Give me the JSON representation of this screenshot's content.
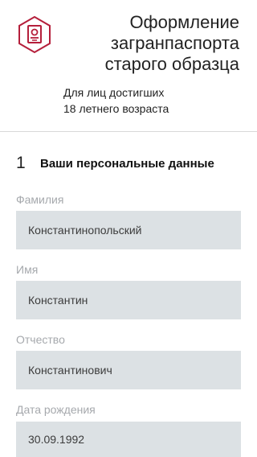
{
  "header": {
    "title_line1": "Оформление",
    "title_line2": "загранпаспорта",
    "title_line3": "старого образца",
    "subtitle_line1": "Для лиц достигших",
    "subtitle_line2": "18 летнего возраста",
    "logo_icon": "passport-icon",
    "accent_color": "#b51f3b"
  },
  "section": {
    "number": "1",
    "title": "Ваши персональные данные"
  },
  "fields": {
    "lastname": {
      "label": "Фамилия",
      "value": "Константинопольский"
    },
    "firstname": {
      "label": "Имя",
      "value": "Константин"
    },
    "patronymic": {
      "label": "Отчество",
      "value": "Константинович"
    },
    "birthdate": {
      "label": "Дата рождения",
      "value": "30.09.1992"
    }
  }
}
